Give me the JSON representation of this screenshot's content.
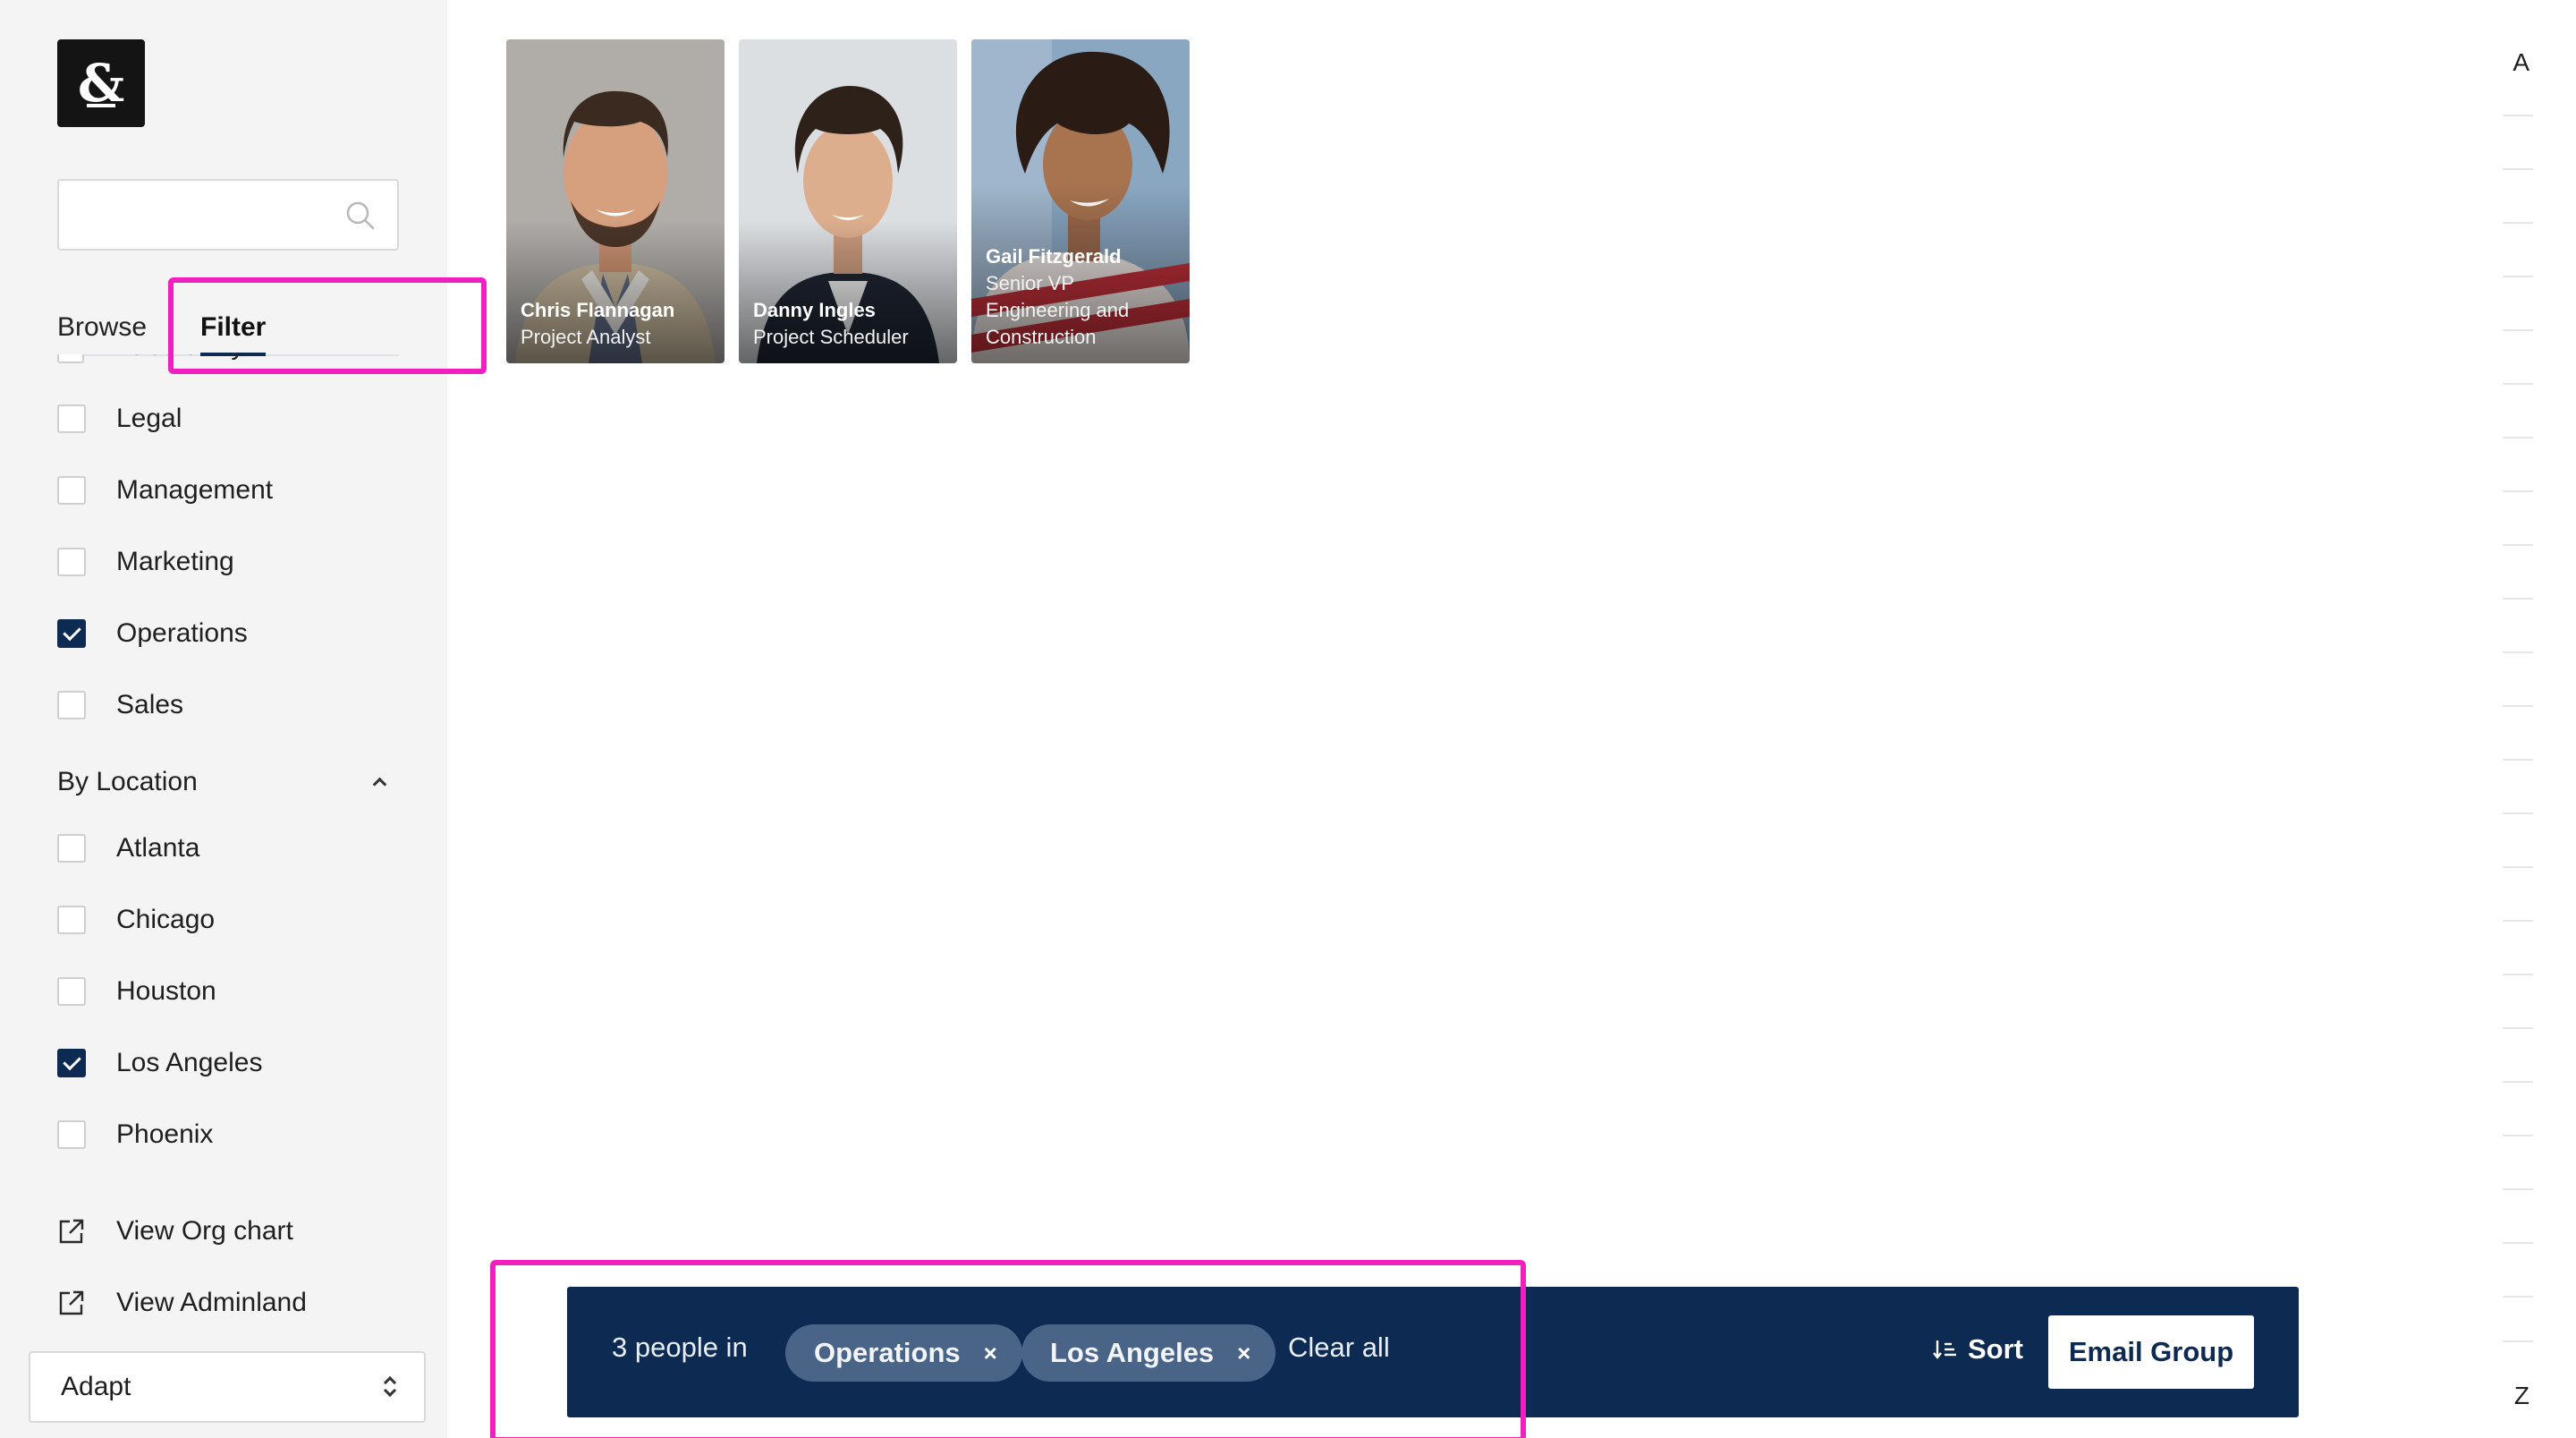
{
  "sidebar": {
    "logo_text": "&",
    "search": {
      "placeholder": "",
      "value": ""
    },
    "tabs": {
      "browse": "Browse",
      "filter": "Filter"
    },
    "partial_item": "Laboratory",
    "departments": [
      {
        "label": "Legal",
        "checked": false
      },
      {
        "label": "Management",
        "checked": false
      },
      {
        "label": "Marketing",
        "checked": false
      },
      {
        "label": "Operations",
        "checked": true
      },
      {
        "label": "Sales",
        "checked": false
      }
    ],
    "location_heading": "By Location",
    "locations": [
      {
        "label": "Atlanta",
        "checked": false
      },
      {
        "label": "Chicago",
        "checked": false
      },
      {
        "label": "Houston",
        "checked": false
      },
      {
        "label": "Los Angeles",
        "checked": true
      },
      {
        "label": "Phoenix",
        "checked": false
      }
    ],
    "links": {
      "org_chart": "View Org chart",
      "adminland": "View Adminland"
    },
    "company_select": "Adapt"
  },
  "people": [
    {
      "name": "Chris Flannagan",
      "title": "Project Analyst"
    },
    {
      "name": "Danny Ingles",
      "title": "Project Scheduler"
    },
    {
      "name": "Gail Fitzgerald",
      "title": "Senior VP Engineering and Construction"
    }
  ],
  "alphabet": {
    "first": "A",
    "last": "Z"
  },
  "action_bar": {
    "count_text": "3 people in",
    "chips": [
      {
        "label": "Operations",
        "remove": "×"
      },
      {
        "label": "Los Angeles",
        "remove": "×"
      }
    ],
    "clear_all": "Clear all",
    "sort": "Sort",
    "email_group": "Email Group"
  },
  "colors": {
    "navy": "#0d2a52",
    "chip": "#4a6488",
    "highlight": "#f020c0",
    "sidebar_bg": "#f4f4f5"
  }
}
